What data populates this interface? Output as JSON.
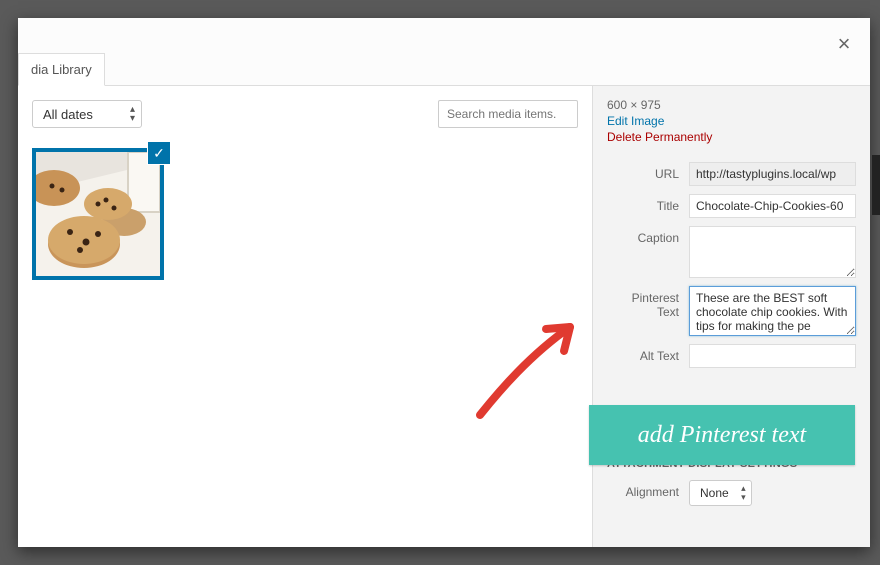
{
  "modal": {
    "tab_label": "dia Library",
    "close_glyph": "×"
  },
  "toolbar": {
    "date_filter": "All dates",
    "search_placeholder": "Search media items."
  },
  "thumbnail": {
    "check_glyph": "✓"
  },
  "details": {
    "dimensions": "600 × 975",
    "edit_label": "Edit Image",
    "delete_label": "Delete Permanently",
    "fields": {
      "url": {
        "label": "URL",
        "value": "http://tastyplugins.local/wp"
      },
      "title": {
        "label": "Title",
        "value": "Chocolate-Chip-Cookies-60"
      },
      "caption": {
        "label": "Caption",
        "value": ""
      },
      "pinterest": {
        "label": "Pinterest Text",
        "value": "These are the BEST soft chocolate chip cookies. With tips for making the pe"
      },
      "alt": {
        "label": "Alt Text",
        "value": ""
      }
    },
    "attachment_heading": "ATTACHMENT DISPLAY SETTINGS",
    "alignment": {
      "label": "Alignment",
      "value": "None"
    }
  },
  "callout_text": "add Pinterest text"
}
